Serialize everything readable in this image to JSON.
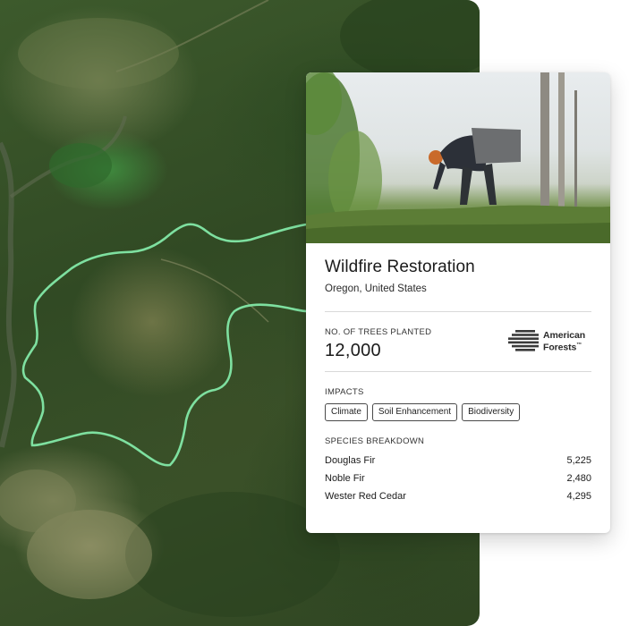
{
  "card": {
    "title": "Wildfire Restoration",
    "location": "Oregon, United States",
    "trees_label": "NO. OF TREES PLANTED",
    "trees_value": "12,000",
    "partner_logo": {
      "line1": "American",
      "line2": "Forests",
      "trademark": "™",
      "icon": "stacked-stripes-logo-icon"
    },
    "impacts_label": "IMPACTS",
    "impacts": [
      "Climate",
      "Soil Enhancement",
      "Biodiversity"
    ],
    "species_label": "SPECIES BREAKDOWN",
    "species": [
      {
        "name": "Douglas Fir",
        "count": "5,225"
      },
      {
        "name": "Noble Fir",
        "count": "2,480"
      },
      {
        "name": "Wester Red Cedar",
        "count": "4,295"
      }
    ]
  },
  "colors": {
    "outline": "#7ee0a0",
    "forest_dark": "#2c4a22",
    "meadow": "#7b8257",
    "card_bg": "#ffffff",
    "text": "#1b1b1b"
  }
}
